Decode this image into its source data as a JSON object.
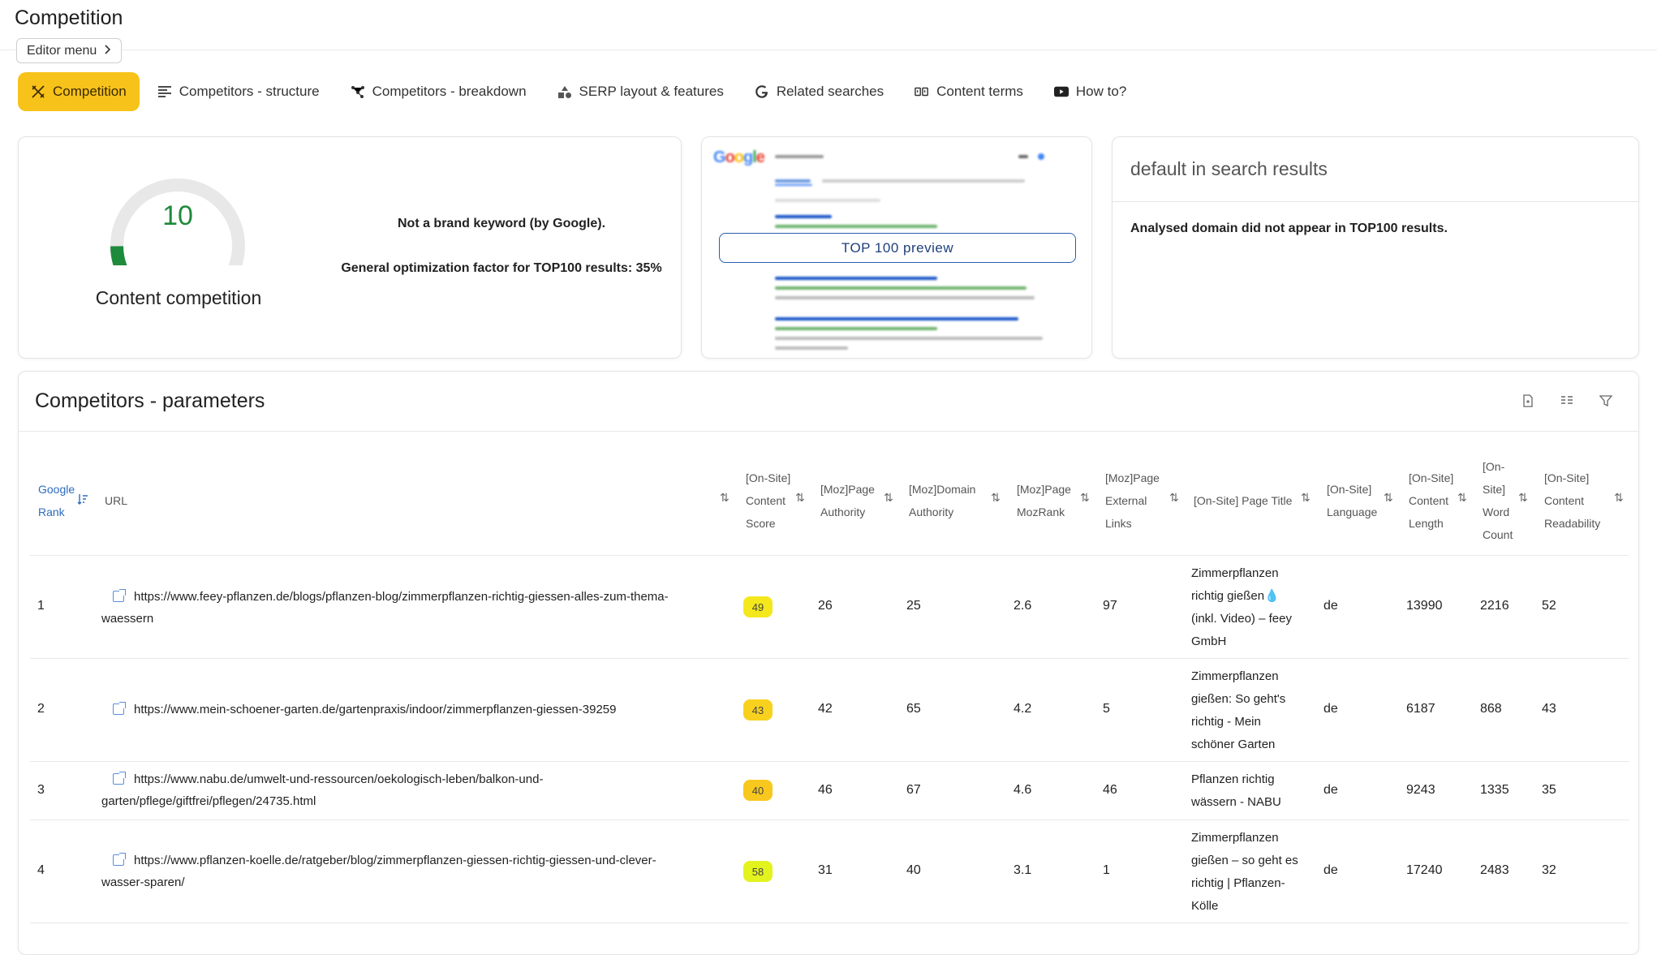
{
  "page": {
    "title": "Competition",
    "editor_menu": "Editor menu"
  },
  "tabs": [
    {
      "label": "Competition"
    },
    {
      "label": "Competitors - structure"
    },
    {
      "label": "Competitors - breakdown"
    },
    {
      "label": "SERP layout & features"
    },
    {
      "label": "Related searches"
    },
    {
      "label": "Content terms"
    },
    {
      "label": "How to?"
    }
  ],
  "gauge": {
    "value": "10",
    "level": 0.1,
    "label": "Content competition",
    "color": "#1e8a3c"
  },
  "notes": {
    "brand": "Not a brand keyword (by Google).",
    "optimization": "General optimization factor for TOP100 results: 35%"
  },
  "preview": {
    "button": "TOP 100 preview"
  },
  "default_card": {
    "title": "default in search results",
    "message": "Analysed domain did not appear in TOP100 results."
  },
  "table": {
    "title": "Competitors - parameters",
    "headers": {
      "rank": [
        "Google",
        "Rank"
      ],
      "url": "URL",
      "content_score": [
        "[On-Site]",
        "Content",
        "Score"
      ],
      "page_authority": [
        "[Moz]Page",
        "Authority"
      ],
      "domain_authority": [
        "[Moz]Domain",
        "Authority"
      ],
      "mozrank": [
        "[Moz]Page",
        "MozRank"
      ],
      "external_links": [
        "[Moz]Page",
        "External",
        "Links"
      ],
      "page_title": "[On-Site] Page Title",
      "language": [
        "[On-Site]",
        "Language"
      ],
      "content_length": [
        "[On-Site]",
        "Content",
        "Length"
      ],
      "word_count": [
        "[On-",
        "Site]",
        "Word",
        "Count"
      ],
      "readability": [
        "[On-Site]",
        "Content",
        "Readability"
      ]
    },
    "rows": [
      {
        "rank": "1",
        "url_line1": "https://www.feey-pflanzen.de/blogs/pflanzen-blog/zimmerpflanzen-richtig-giessen-alles-zum-thema-",
        "url_line2": "waessern",
        "score": "49",
        "score_color": "#f4e81c",
        "pa": "26",
        "da": "25",
        "mozrank": "2.6",
        "links": "97",
        "title_lines": [
          "Zimmerpflanzen",
          "richtig gießen💧",
          "(inkl. Video) – feey",
          "GmbH"
        ],
        "lang": "de",
        "length": "13990",
        "words": "2216",
        "read": "52"
      },
      {
        "rank": "2",
        "url_line1": "https://www.mein-schoener-garten.de/gartenpraxis/indoor/zimmerpflanzen-giessen-39259",
        "url_line2": "",
        "score": "43",
        "score_color": "#f8d11e",
        "pa": "42",
        "da": "65",
        "mozrank": "4.2",
        "links": "5",
        "title_lines": [
          "Zimmerpflanzen",
          "gießen: So geht's",
          "richtig - Mein",
          "schöner Garten"
        ],
        "lang": "de",
        "length": "6187",
        "words": "868",
        "read": "43"
      },
      {
        "rank": "3",
        "url_line1": "https://www.nabu.de/umwelt-und-ressourcen/oekologisch-leben/balkon-und-",
        "url_line2": "garten/pflege/giftfrei/pflegen/24735.html",
        "score": "40",
        "score_color": "#f8c81e",
        "pa": "46",
        "da": "67",
        "mozrank": "4.6",
        "links": "46",
        "title_lines": [
          "Pflanzen richtig",
          "wässern - NABU"
        ],
        "lang": "de",
        "length": "9243",
        "words": "1335",
        "read": "35"
      },
      {
        "rank": "4",
        "url_line1": "https://www.pflanzen-koelle.de/ratgeber/blog/zimmerpflanzen-giessen-richtig-giessen-und-clever-",
        "url_line2": "wasser-sparen/",
        "score": "58",
        "score_color": "#e2f31e",
        "pa": "31",
        "da": "40",
        "mozrank": "3.1",
        "links": "1",
        "title_lines": [
          "Zimmerpflanzen",
          "gießen – so geht es",
          "richtig | Pflanzen-",
          "Kölle"
        ],
        "lang": "de",
        "length": "17240",
        "words": "2483",
        "read": "32"
      }
    ]
  }
}
